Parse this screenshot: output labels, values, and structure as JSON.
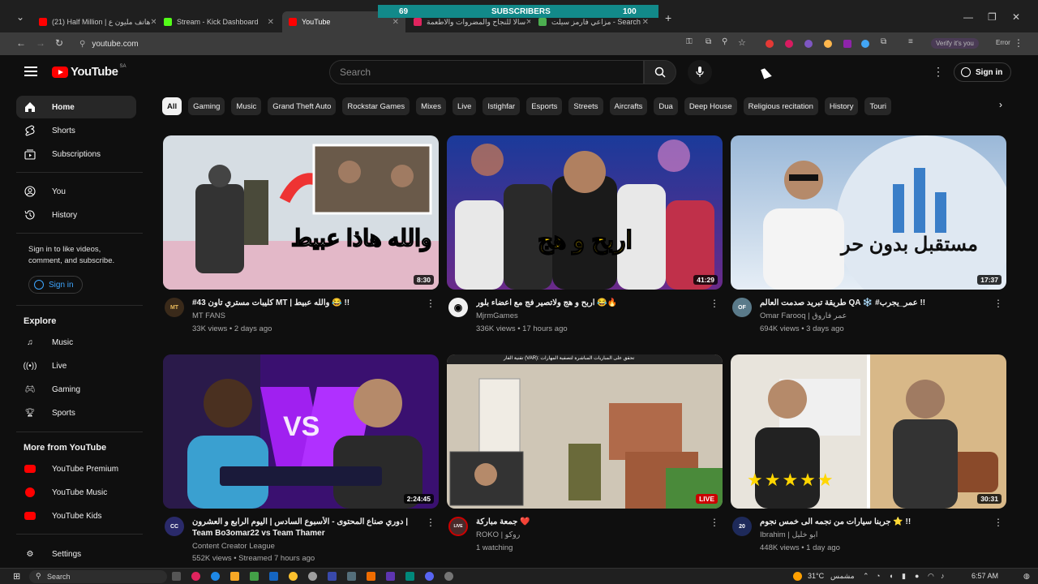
{
  "browser": {
    "tabs": [
      {
        "label": "(21) Half Million | هاتف مليون ع",
        "favicon_color": "#ff0000",
        "active": false
      },
      {
        "label": "Stream - Kick Dashboard",
        "favicon_color": "#53fc18",
        "active": false
      },
      {
        "label": "YouTube",
        "favicon_color": "#ff0000",
        "active": true
      },
      {
        "label": "سالا للنجاح والمضروات والاطعمة",
        "favicon_color": "#e0245e",
        "active": false
      },
      {
        "label": "مزاعي فارمز سيلت - Search",
        "favicon_color": "#4caf50",
        "active": false
      }
    ],
    "overlay": {
      "left_count": "69",
      "label": "SUBSCRIBERS",
      "right_count": "100"
    },
    "url": "youtube.com",
    "verify_label": "Verify it's you",
    "error_label": "Error"
  },
  "header": {
    "logo_text": "YouTube",
    "country_code": "SA",
    "search_placeholder": "Search",
    "signin_label": "Sign in"
  },
  "sidebar": {
    "main": [
      {
        "label": "Home",
        "icon": "home-icon",
        "active": true
      },
      {
        "label": "Shorts",
        "icon": "shorts-icon"
      },
      {
        "label": "Subscriptions",
        "icon": "subscriptions-icon"
      }
    ],
    "you": [
      {
        "label": "You",
        "icon": "user-icon"
      },
      {
        "label": "History",
        "icon": "history-icon"
      }
    ],
    "signin_note": "Sign in to like videos, comment, and subscribe.",
    "signin_label": "Sign in",
    "explore_title": "Explore",
    "explore": [
      {
        "label": "Music",
        "icon": "music-icon"
      },
      {
        "label": "Live",
        "icon": "live-icon"
      },
      {
        "label": "Gaming",
        "icon": "gaming-icon"
      },
      {
        "label": "Sports",
        "icon": "trophy-icon"
      }
    ],
    "more_title": "More from YouTube",
    "more": [
      {
        "label": "YouTube Premium",
        "icon": "youtube-premium-icon"
      },
      {
        "label": "YouTube Music",
        "icon": "youtube-music-icon"
      },
      {
        "label": "YouTube Kids",
        "icon": "youtube-kids-icon"
      }
    ],
    "settings_label": "Settings"
  },
  "chips": [
    "All",
    "Gaming",
    "Music",
    "Grand Theft Auto",
    "Rockstar Games",
    "Mixes",
    "Live",
    "Istighfar",
    "Esports",
    "Streets",
    "Aircrafts",
    "Dua",
    "Deep House",
    "Religious recitation",
    "History",
    "Touri"
  ],
  "videos": [
    {
      "title": "#43 كليبات مستري تاون MT | والله عبيط 😂 !!",
      "channel": "MT FANS",
      "stats": "33K views • 2 days ago",
      "duration": "8:30",
      "avatar_text": "MT",
      "avatar_color": "#3a2a1a",
      "thumb_overlay": "والله هاذا عبيط"
    },
    {
      "title": "اربح و هج ولاتصير فج مع اعضاء بلور 😂🔥",
      "channel": "MjrmGames",
      "stats": "336K views • 17 hours ago",
      "duration": "41:29",
      "avatar_text": "◉",
      "avatar_color": "#f1f1f1",
      "thumb_overlay": "اربح و هج"
    },
    {
      "title": "طريقة تبريد صدمت العالم QA ❄️ #عمر_يجرب !!",
      "channel": "Omar Farooq | عمر فاروق",
      "stats": "694K views • 3 days ago",
      "duration": "17:37",
      "avatar_text": "OF",
      "avatar_color": "#5a7a8a",
      "thumb_overlay": "مستقبل بدون حر"
    },
    {
      "title": "دوري صناع المحتوى - الأسبوع السادس | اليوم الرابع و العشرون | Team Bo3omar22 vs Team Thamer",
      "channel": "Content Creator League",
      "stats": "552K views • Streamed 7 hours ago",
      "duration": "2:24:45",
      "avatar_text": "CC",
      "avatar_color": "#2a2a6a",
      "thumb_overlay": "VS"
    },
    {
      "title": "جمعة مباركة ❤️",
      "channel": "ROKO | روكو",
      "stats": "1 watching",
      "duration": "",
      "live_label": "LIVE",
      "avatar_text": "LIVE",
      "avatar_color": "#4a2a2a",
      "thumb_overlay": "تقنية الفار (VAR): تحقق على المباريات المباشرة لتصفية المهارات"
    },
    {
      "title": "جربنا سيارات من نجمه الى خمس نجوم ⭐ !!",
      "channel": "Ibrahim | ابو خليل",
      "stats": "448K views • 1 day ago",
      "duration": "30:31",
      "avatar_text": "20",
      "avatar_color": "#1e2a5a",
      "thumb_overlay": "★★★★★"
    }
  ],
  "taskbar": {
    "search_label": "Search",
    "weather": "31°C",
    "weather_desc": "مشمس",
    "time": "6:57 AM"
  },
  "colors": {
    "accent": "#ff0000",
    "link": "#3ea6ff",
    "bg": "#0f0f0f"
  }
}
